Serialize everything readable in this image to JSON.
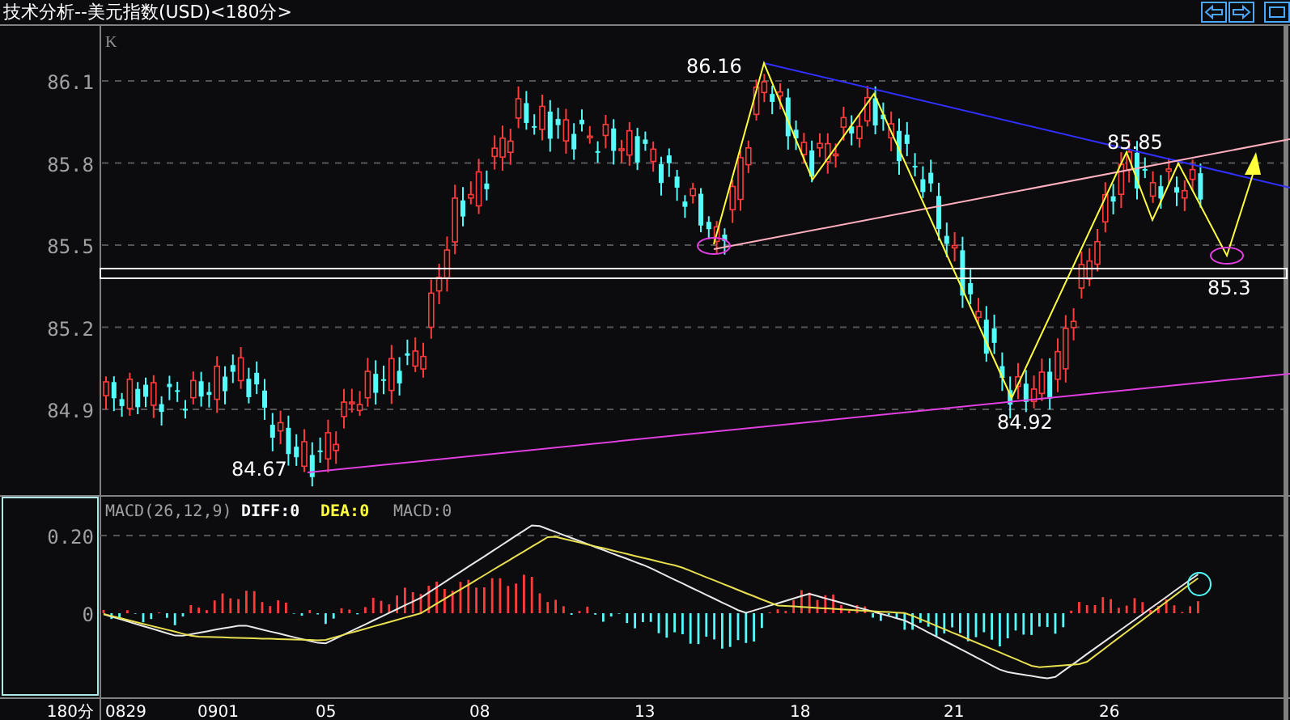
{
  "window": {
    "title": "技术分析--美元指数(USD)<180分>"
  },
  "price_panel": {
    "label": "K",
    "y_axis": [
      "86.1",
      "85.8",
      "85.5",
      "85.2",
      "84.9"
    ],
    "annotations": [
      {
        "text": "86.16"
      },
      {
        "text": "85.85"
      },
      {
        "text": "84.92"
      },
      {
        "text": "84.67"
      },
      {
        "text": "85.3"
      }
    ]
  },
  "macd_panel": {
    "legend": [
      {
        "text": "MACD(26,12,9)",
        "kind": "name"
      },
      {
        "text": "DIFF:0",
        "kind": "diff"
      },
      {
        "text": "DEA:0",
        "kind": "dea"
      },
      {
        "text": "MACD:0",
        "kind": "macd"
      }
    ],
    "y_axis": [
      "0.20",
      "0"
    ]
  },
  "x_axis": {
    "period": "180分",
    "labels": [
      "0829",
      "0901",
      "05",
      "08",
      "13",
      "18",
      "21",
      "26"
    ]
  }
}
